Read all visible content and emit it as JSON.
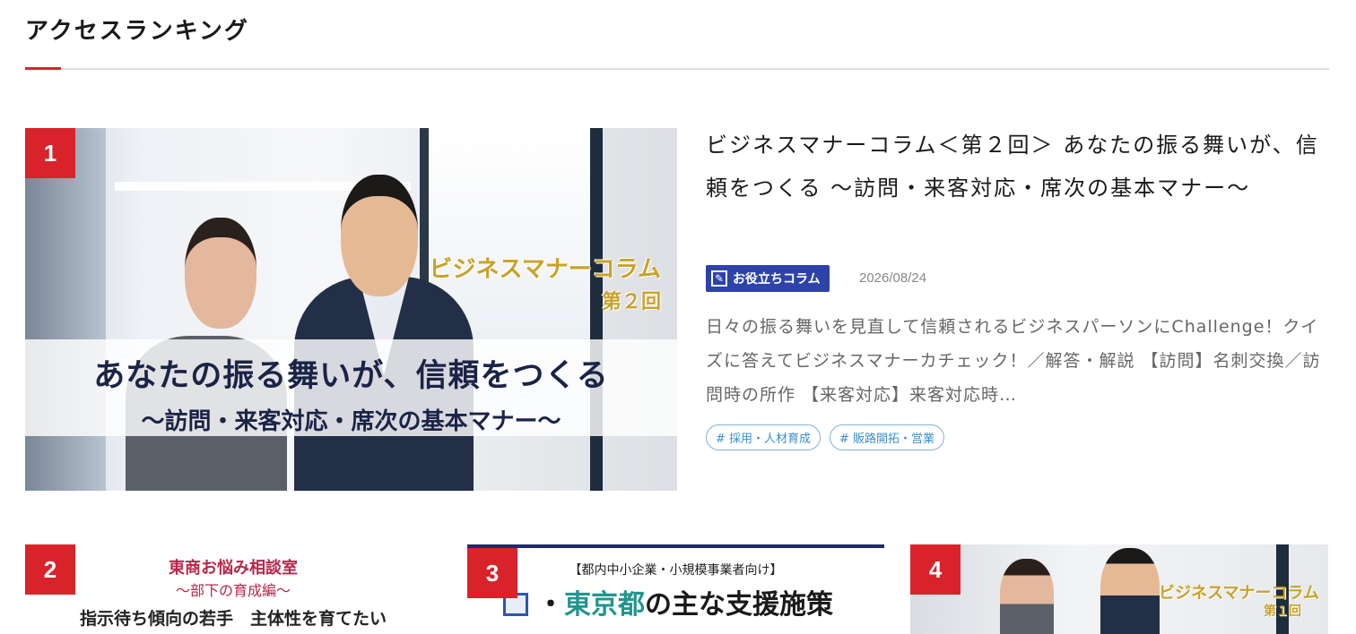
{
  "section": {
    "title": "アクセスランキング"
  },
  "featured": {
    "rank": "1",
    "title": "ビジネスマナーコラム＜第２回＞ あなたの振る舞いが、信頼をつくる ～訪問・来客対応・席次の基本マナー～",
    "thumbnail": {
      "series_line1": "ビジネスマナーコラム",
      "series_line2": "第２回",
      "headline": "あなたの振る舞いが、信頼をつくる",
      "subheadline": "～訪問・来客対応・席次の基本マナー～"
    },
    "category": {
      "label": "お役立ちコラム",
      "icon": "edit-icon"
    },
    "date": "2026/08/24",
    "excerpt": "日々の振る舞いを見直して信頼されるビジネスパーソンにChallenge！クイズに答えてビジネスマナーカチェック！／解答・解説 【訪問】名刺交換／訪問時の所作 【来客対応】来客対応時…",
    "tags": [
      "# 採用・人材育成",
      "# 販路開拓・営業"
    ]
  },
  "cards": [
    {
      "rank": "2",
      "line1": "東商お悩み相談室",
      "line2": "～部下の育成編～",
      "line3": "指示待ち傾向の若手　主体性を育てたい"
    },
    {
      "rank": "3",
      "line1": "【都内中小企業・小規模事業者向け】",
      "line2_pre": "・",
      "line2_accent": "東京都",
      "line2_post": "の主な支援施策"
    },
    {
      "rank": "4",
      "line1": "ビジネスマナーコラム",
      "line2": "第１回"
    }
  ],
  "colors": {
    "accent_red": "#d8232a",
    "category_blue": "#2d43a8",
    "tag_blue": "#3a8fd0"
  }
}
